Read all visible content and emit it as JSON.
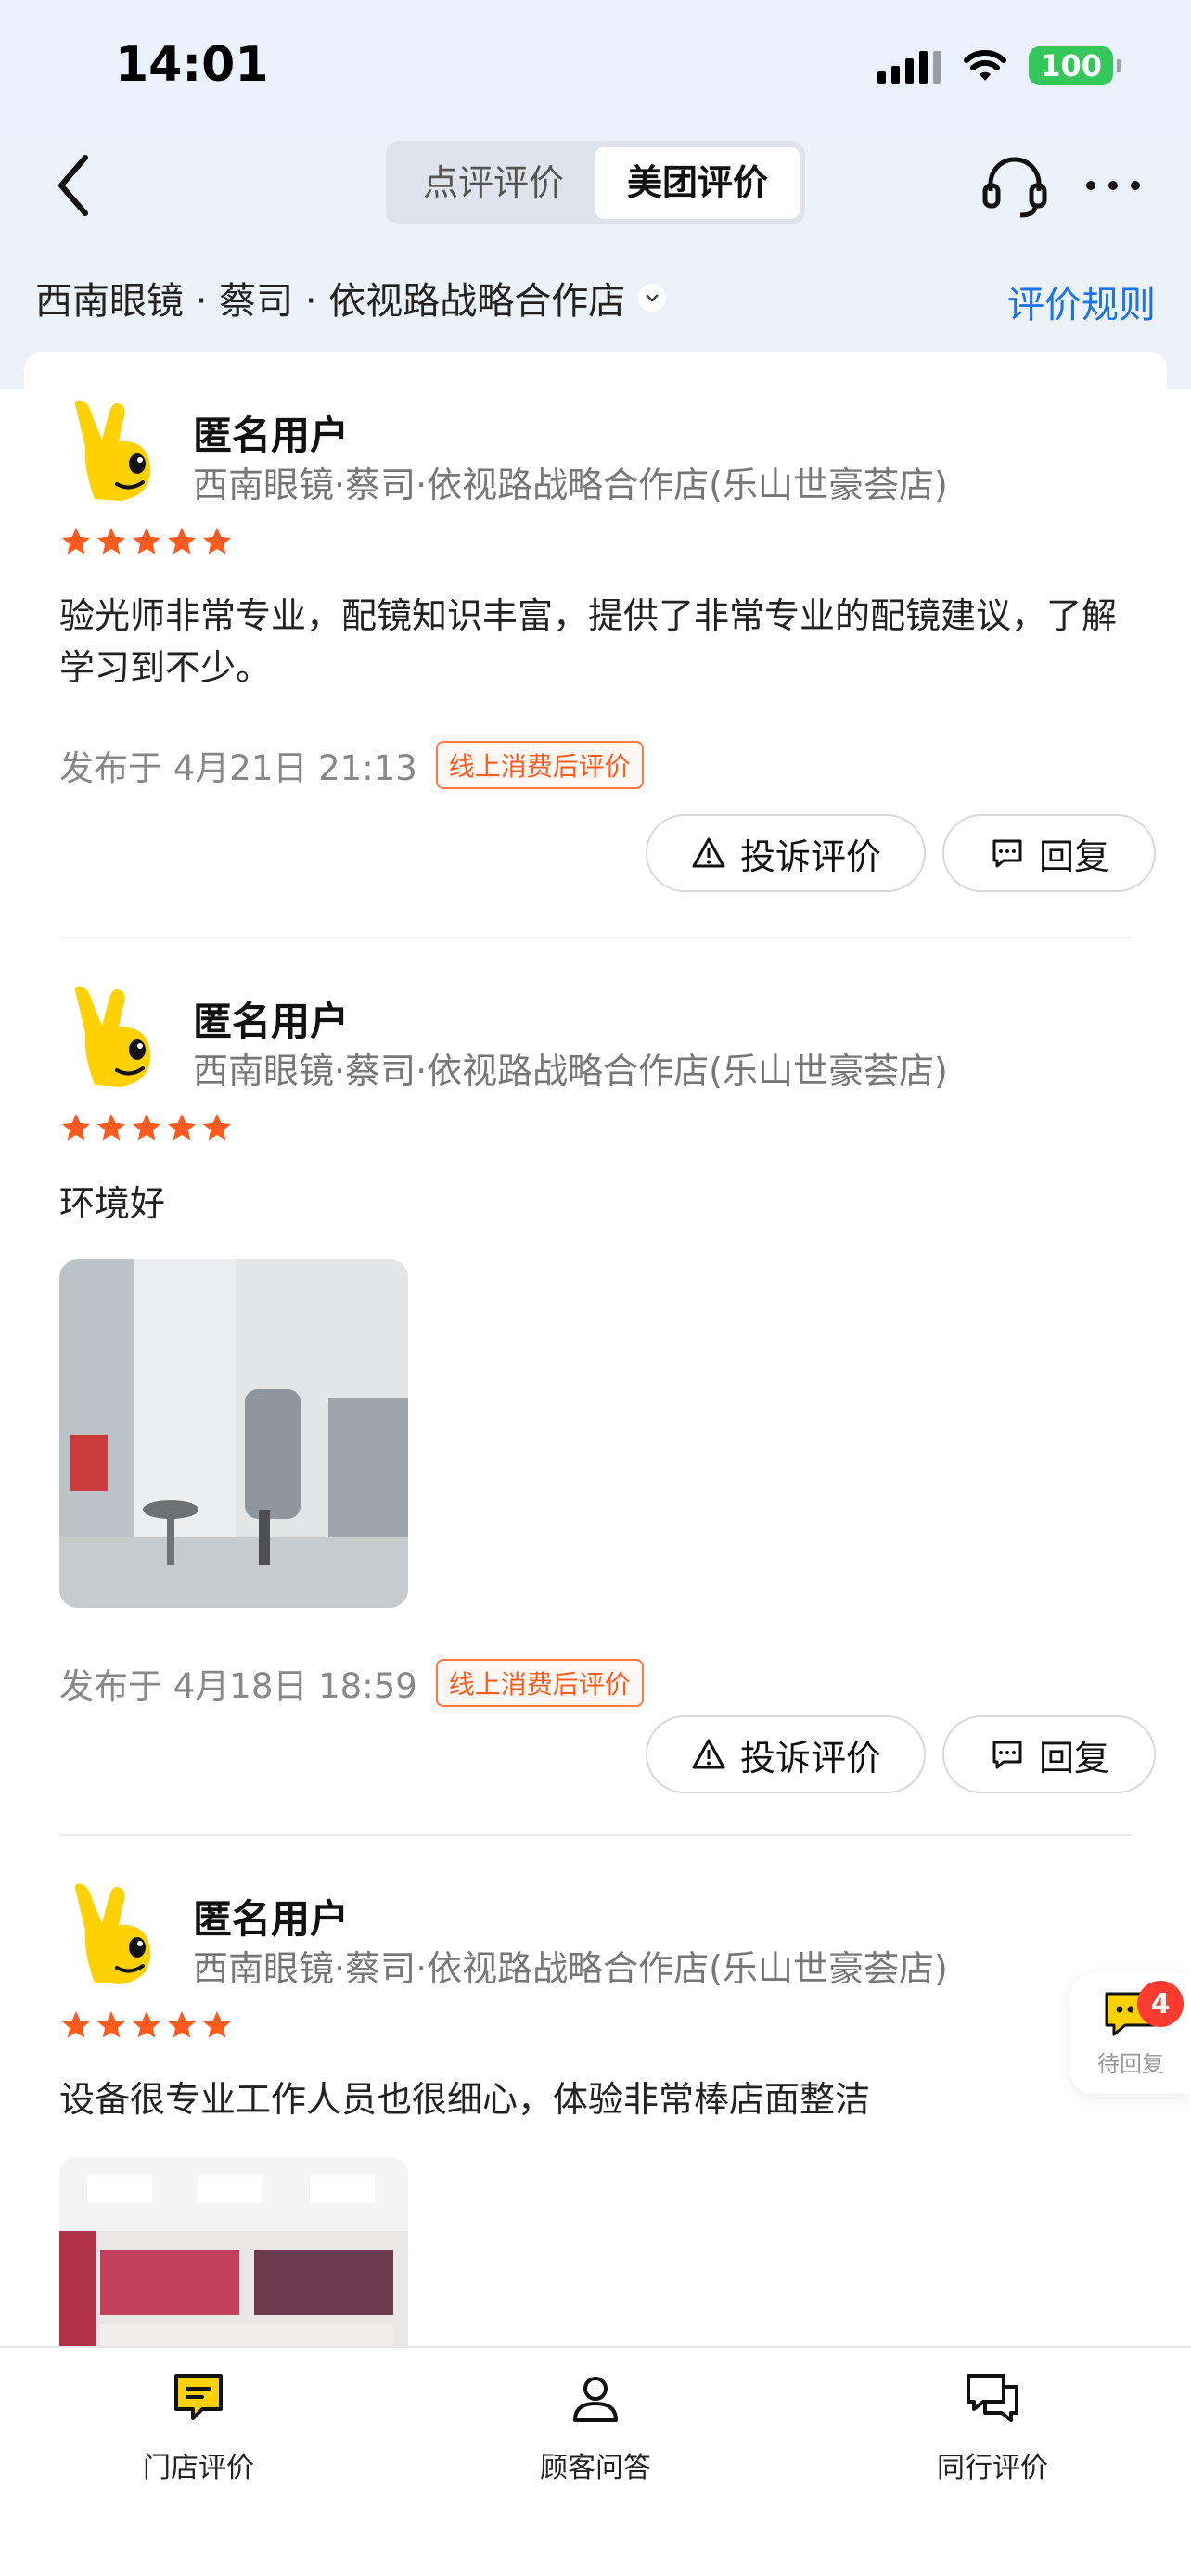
{
  "status_bar": {
    "time": "14:01",
    "battery": "100"
  },
  "nav": {
    "tabs": [
      {
        "label": "点评评价",
        "active": false
      },
      {
        "label": "美团评价",
        "active": true
      }
    ]
  },
  "shop": {
    "name": "西南眼镜 · 蔡司 · 依视路战略合作店",
    "rules_link": "评价规则"
  },
  "reviews": [
    {
      "user": "匿名用户",
      "store": "西南眼镜·蔡司·依视路战略合作店(乐山世豪荟店)",
      "rating": 5,
      "text": "验光师非常专业，配镜知识丰富，提供了非常专业的配镜建议，了解学习到不少。",
      "published": "发布于 4月21日 21:13",
      "tag": "线上消费后评价",
      "complain_label": "投诉评价",
      "reply_label": "回复"
    },
    {
      "user": "匿名用户",
      "store": "西南眼镜·蔡司·依视路战略合作店(乐山世豪荟店)",
      "rating": 5,
      "text": "环境好",
      "published": "发布于 4月18日 18:59",
      "tag": "线上消费后评价",
      "complain_label": "投诉评价",
      "reply_label": "回复"
    },
    {
      "user": "匿名用户",
      "store": "西南眼镜·蔡司·依视路战略合作店(乐山世豪荟店)",
      "rating": 5,
      "text": "设备很专业工作人员也很细心，体验非常棒店面整洁"
    }
  ],
  "floating": {
    "label": "待回复",
    "count": "4"
  },
  "bottom_tabs": [
    {
      "label": "门店评价",
      "icon": "store-review-icon",
      "active": true
    },
    {
      "label": "顾客问答",
      "icon": "customer-qa-icon",
      "active": false
    },
    {
      "label": "同行评价",
      "icon": "peer-review-icon",
      "active": false
    }
  ],
  "colors": {
    "accent_blue": "#1a73e8",
    "star_orange": "#ff5a1f",
    "battery_green": "#34c759",
    "brand_yellow": "#ffd100"
  }
}
